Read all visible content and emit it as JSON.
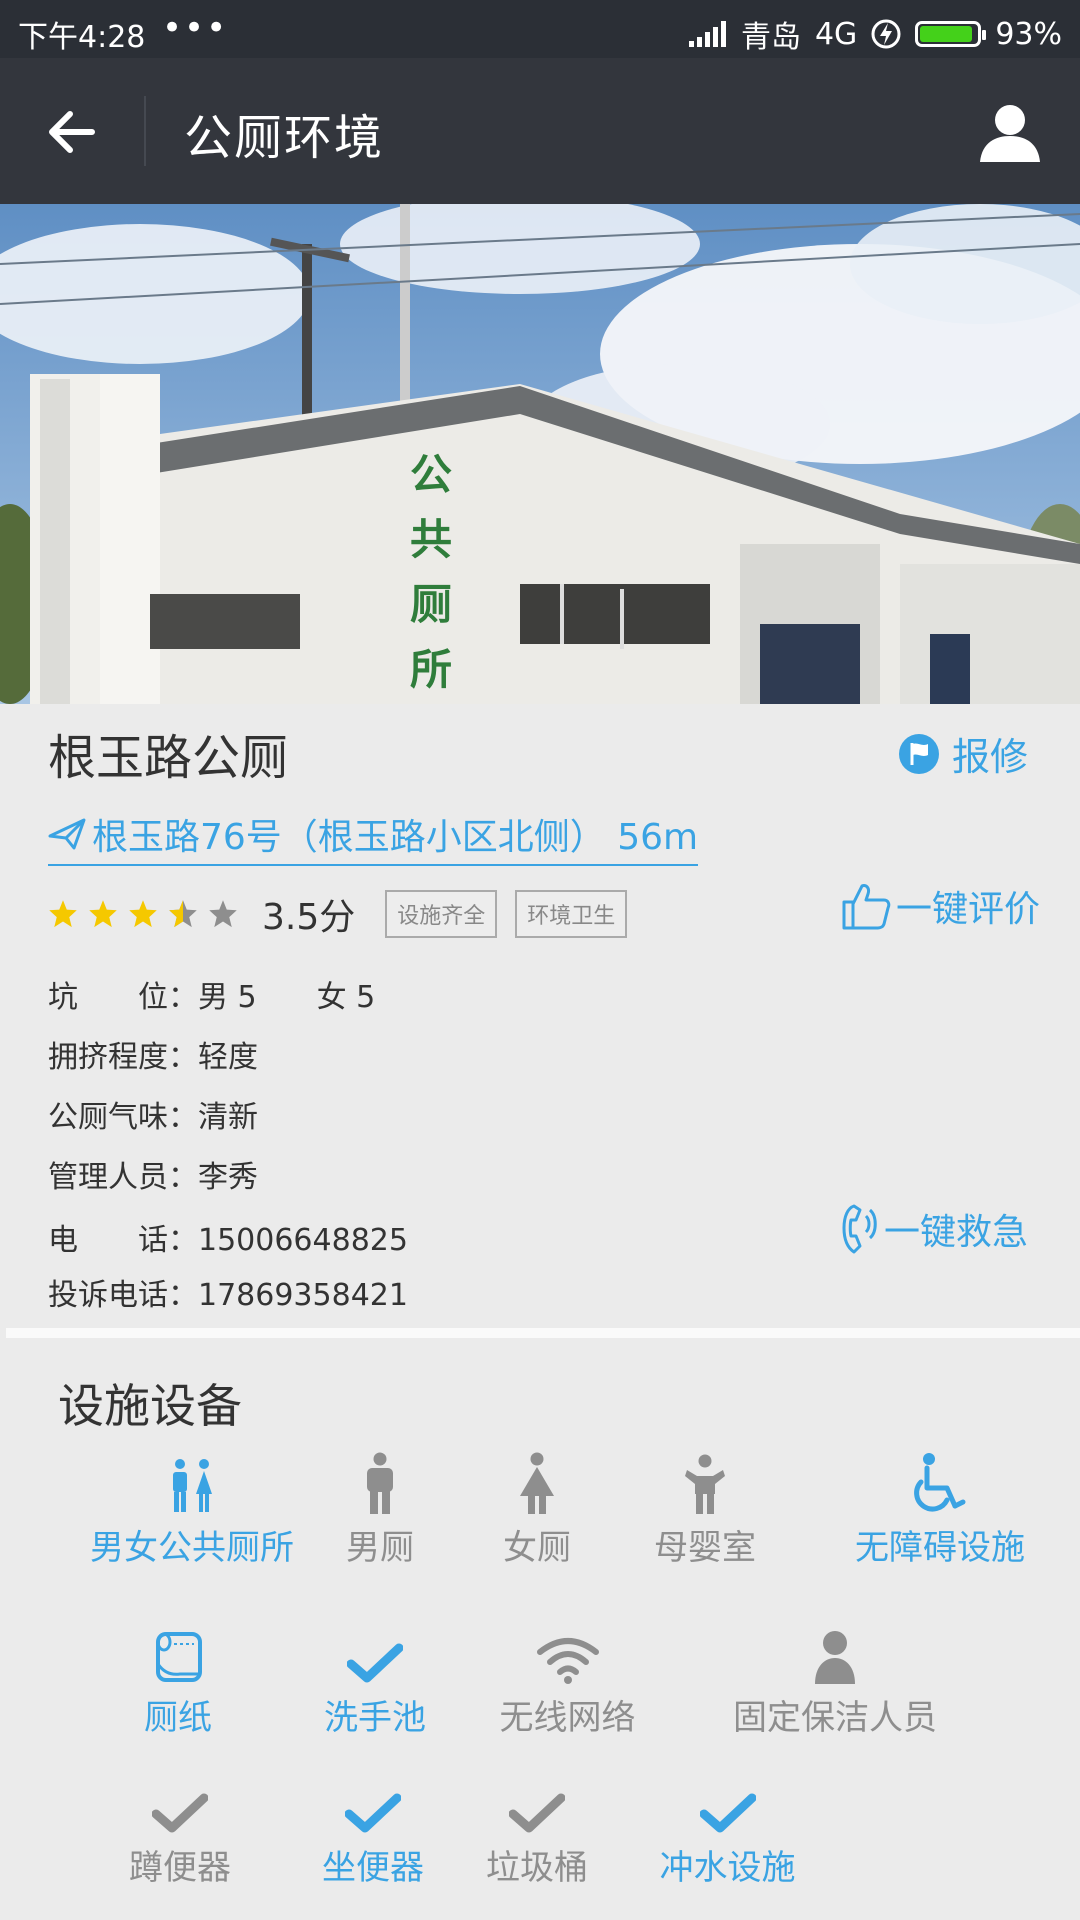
{
  "status_bar": {
    "time": "下午4:28",
    "dots": "•••",
    "carrier": "青岛",
    "network": "4G",
    "battery": "93%"
  },
  "app_bar": {
    "title": "公厕环境"
  },
  "toilet": {
    "name": "根玉路公厕",
    "repair_label": "报修",
    "address": "根玉路76号（根玉路小区北侧） 56m",
    "rating_stars": 3.5,
    "score": "3.5分",
    "tags": [
      "设施齐全",
      "环境卫生"
    ],
    "rate_label": "一键评价",
    "details": [
      {
        "label": "坑　　位：",
        "value": "男 5　　女 5"
      },
      {
        "label": "拥挤程度：",
        "value": "轻度"
      },
      {
        "label": "公厕气味：",
        "value": "清新"
      },
      {
        "label": "管理人员：",
        "value": "李秀"
      },
      {
        "label": "电　　话：",
        "value": "15006648825"
      },
      {
        "label": "投诉电话：",
        "value": "17869358421"
      }
    ],
    "sos_label": "一键救急"
  },
  "facilities": {
    "title": "设施设备",
    "items": [
      {
        "label": "男女公共厕所",
        "icon": "unisex-restroom-icon",
        "active": true
      },
      {
        "label": "男厕",
        "icon": "man-icon",
        "active": false
      },
      {
        "label": "女厕",
        "icon": "woman-icon",
        "active": false
      },
      {
        "label": "母婴室",
        "icon": "baby-room-icon",
        "active": false
      },
      {
        "label": "无障碍设施",
        "icon": "wheelchair-icon",
        "active": true
      },
      {
        "label": "厕纸",
        "icon": "toilet-paper-icon",
        "active": true
      },
      {
        "label": "洗手池",
        "icon": "check-icon",
        "active": true
      },
      {
        "label": "无线网络",
        "icon": "wifi-icon",
        "active": false
      },
      {
        "label": "固定保洁人员",
        "icon": "person-icon",
        "active": false
      },
      {
        "label": "蹲便器",
        "icon": "check-icon",
        "active": false
      },
      {
        "label": "坐便器",
        "icon": "check-icon",
        "active": true
      },
      {
        "label": "垃圾桶",
        "icon": "check-icon",
        "active": false
      },
      {
        "label": "冲水设施",
        "icon": "check-icon",
        "active": true
      }
    ]
  },
  "colors": {
    "accent": "#3aa3e3",
    "inactive": "#8e8e8e",
    "star": "#f5c800",
    "appbar": "#33363d"
  }
}
